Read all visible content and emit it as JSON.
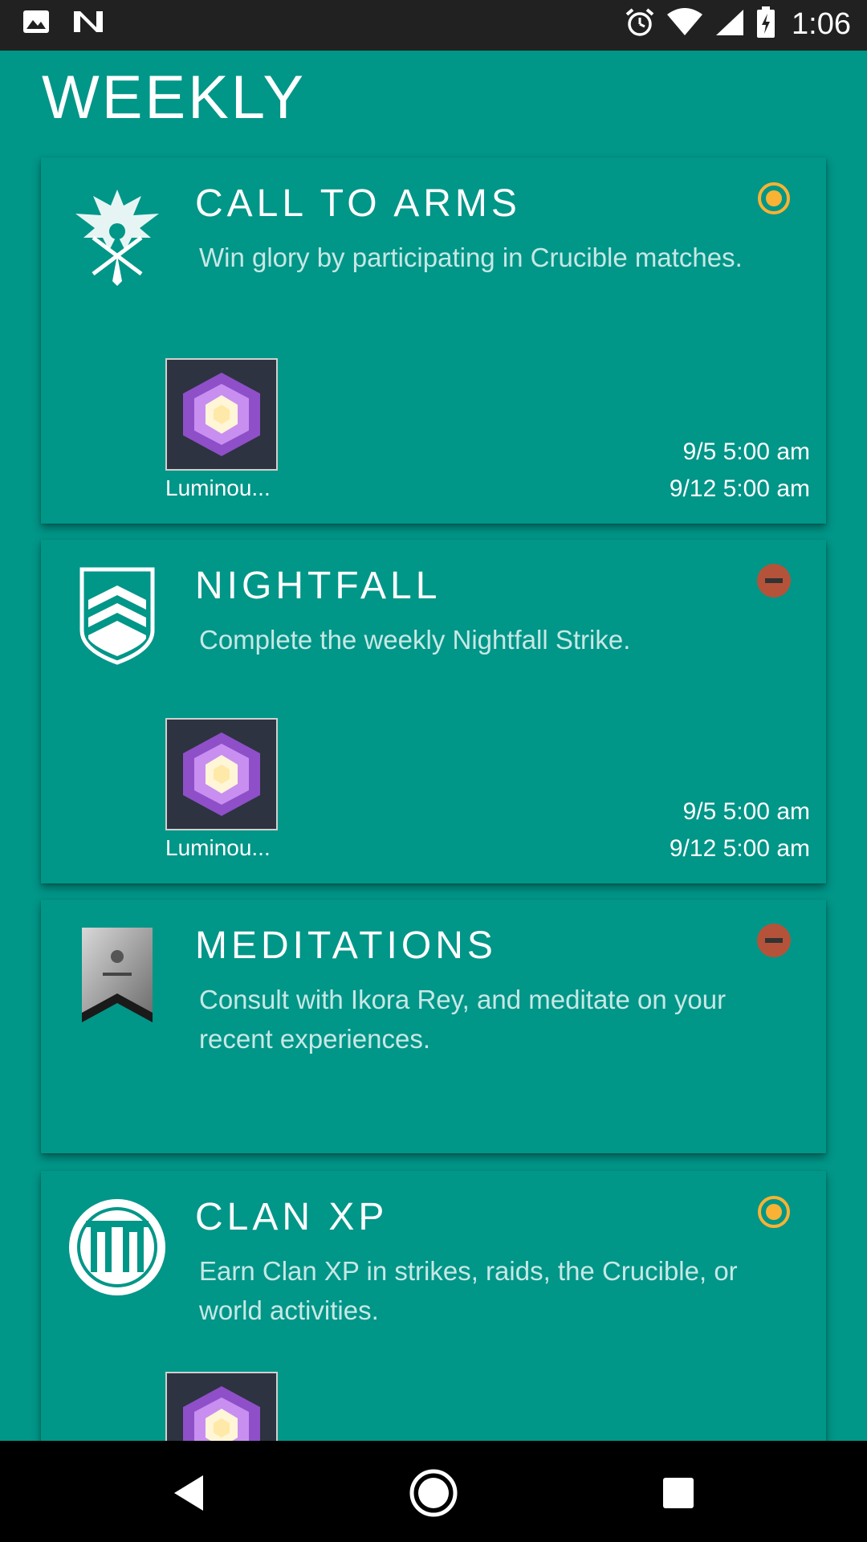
{
  "status_bar": {
    "time": "1:06",
    "icons": [
      "image-notification-icon",
      "n-notification-icon",
      "alarm-icon",
      "wifi-icon",
      "cell-signal-icon",
      "battery-icon"
    ]
  },
  "page": {
    "title": "WEEKLY"
  },
  "cards": [
    {
      "title": "CALL TO ARMS",
      "description": "Win glory by participating in Crucible matches.",
      "icon": "crucible-emblem-icon",
      "status": "active",
      "reward_label": "Luminou...",
      "start": "9/5 5:00 am",
      "end": "9/12 5:00 am"
    },
    {
      "title": "NIGHTFALL",
      "description": "Complete the weekly Nightfall Strike.",
      "icon": "vanguard-shield-icon",
      "status": "inactive",
      "reward_label": "Luminou...",
      "start": "9/5 5:00 am",
      "end": "9/12 5:00 am"
    },
    {
      "title": "MEDITATIONS",
      "description": "Consult with Ikora Rey, and meditate on your recent experiences.",
      "icon": "banner-icon",
      "status": "inactive"
    },
    {
      "title": "CLAN XP",
      "description": "Earn Clan XP in strikes, raids, the Crucible, or world activities.",
      "icon": "clan-emblem-icon",
      "status": "active"
    }
  ],
  "colors": {
    "background": "#009688",
    "active_status": "#F9B233",
    "inactive_status": "#B5533A",
    "status_bar": "#212121"
  },
  "nav": {
    "icons": [
      "back-icon",
      "home-icon",
      "recents-icon"
    ]
  }
}
